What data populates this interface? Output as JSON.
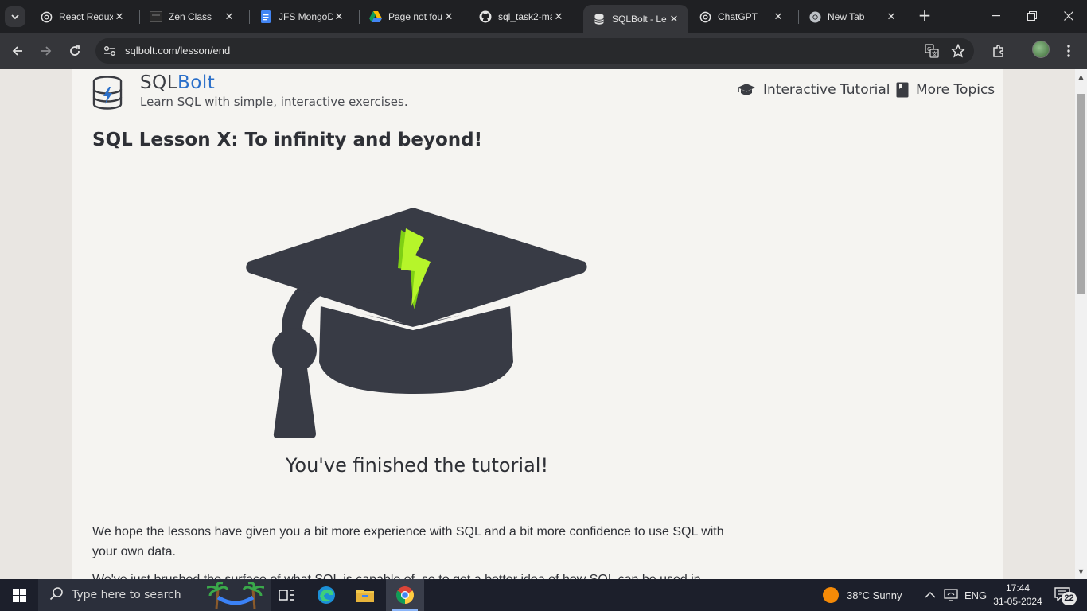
{
  "browser": {
    "tabs": [
      {
        "title": "React Redux",
        "icon": "chatgpt-icon",
        "active": false
      },
      {
        "title": "Zen Class",
        "icon": "zen-class-icon",
        "active": false
      },
      {
        "title": "JFS MongoD",
        "icon": "google-docs-icon",
        "active": false
      },
      {
        "title": "Page not fou",
        "icon": "google-drive-icon",
        "active": false
      },
      {
        "title": "sql_task2-ma",
        "icon": "github-icon",
        "active": false
      },
      {
        "title": "SQLBolt - Le",
        "icon": "database-icon",
        "active": true
      },
      {
        "title": "ChatGPT",
        "icon": "chatgpt-icon",
        "active": false
      },
      {
        "title": "New Tab",
        "icon": "chrome-icon",
        "active": false
      }
    ],
    "address": "sqlbolt.com/lesson/end"
  },
  "site": {
    "brand_prefix": "SQL",
    "brand_suffix": "Bolt",
    "tagline": "Learn SQL with simple, interactive exercises.",
    "nav": {
      "interactive_tutorial": "Interactive Tutorial",
      "more_topics": "More Topics"
    },
    "accent_color": "#2a6fc9"
  },
  "lesson": {
    "title": "SQL Lesson X: To infinity and beyond!",
    "finished_text": "You've finished the tutorial!",
    "paragraph_1": "We hope the lessons have given you a bit more experience with SQL and a bit more confidence to use SQL with your own data.",
    "paragraph_2": "We've just brushed the surface of what SQL is capable of, so to get a better idea of how SQL can be used in"
  },
  "taskbar": {
    "search_placeholder": "Type here to search",
    "weather": "38°C  Sunny",
    "language": "ENG",
    "time": "17:44",
    "date": "31-05-2024",
    "notification_count": "22"
  }
}
